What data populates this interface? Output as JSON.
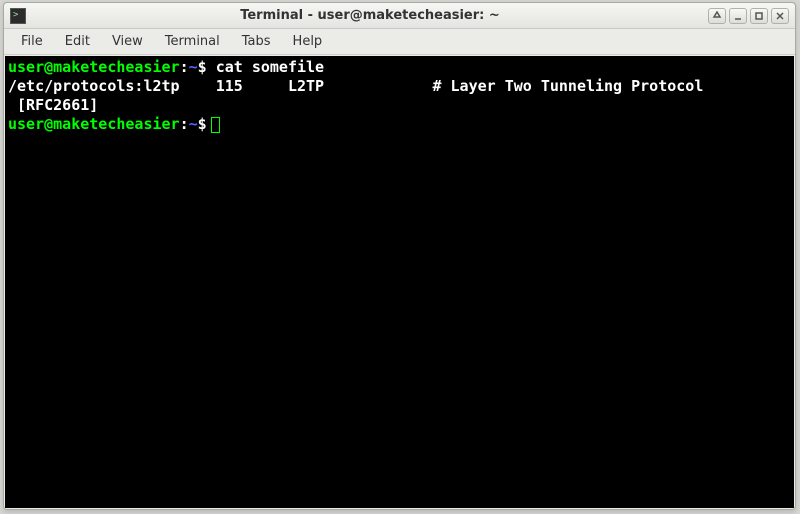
{
  "window": {
    "title": "Terminal - user@maketecheasier: ~"
  },
  "menubar": {
    "items": [
      {
        "label": "File"
      },
      {
        "label": "Edit"
      },
      {
        "label": "View"
      },
      {
        "label": "Terminal"
      },
      {
        "label": "Tabs"
      },
      {
        "label": "Help"
      }
    ]
  },
  "terminal": {
    "prompt_user_host": "user@maketecheasier",
    "prompt_sep1": ":",
    "prompt_cwd": "~",
    "prompt_symbol": "$",
    "line1_cmd": " cat somefile",
    "output1": "/etc/protocols:l2tp    115     L2TP            # Layer Two Tunneling Protocol",
    "output2": " [RFC2661]"
  }
}
